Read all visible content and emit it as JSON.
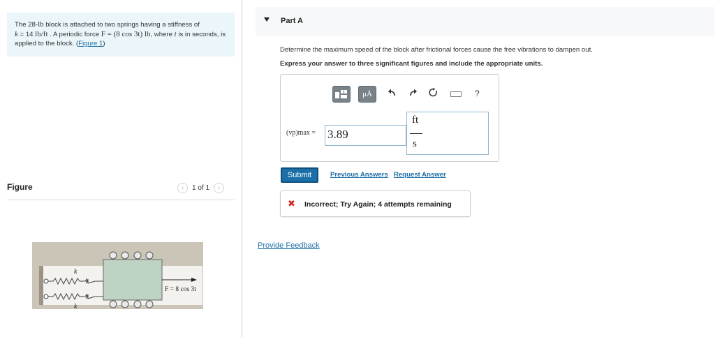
{
  "problem": {
    "text_1": "The 28-",
    "math_lb": "lb",
    "text_2": " block is attached to two springs having a stiffness of",
    "math_k": "k",
    "text_3": " = 14 ",
    "math_unit": "lb/ft",
    "text_4": " . A periodic force ",
    "math_force": "F = (8 cos 3t) lb",
    "text_5": ", where ",
    "math_t": "t",
    "text_6": " is in seconds, is applied to the block. (",
    "figure_link": "Figure 1",
    "text_7": ")"
  },
  "figure_panel": {
    "title": "Figure",
    "pager": "1 of 1",
    "prev_icon": "chevron-left-icon",
    "next_icon": "chevron-right-icon",
    "labels": {
      "k_top": "k",
      "k_bottom": "k",
      "force": "F = 8 cos 3t"
    },
    "colors": {
      "block": "#bfd3c4",
      "ground": "#c9c3b5",
      "wheel": "#e8e8e8"
    }
  },
  "part": {
    "title": "Part A",
    "question": "Determine the maximum speed of the block after frictional forces cause the free vibrations to dampen out.",
    "instruction": "Express your answer to three significant figures and include the appropriate units."
  },
  "toolbar": {
    "templates_icon": "templates-icon",
    "units_label": "μÅ",
    "undo_icon": "undo-icon",
    "redo_icon": "redo-icon",
    "reset_icon": "reset-icon",
    "keyboard_icon": "keyboard-icon",
    "help": "?"
  },
  "answer": {
    "variable": "(vp)max =",
    "value": "3.89",
    "unit_numerator": "ft",
    "unit_denominator": "s"
  },
  "actions": {
    "submit": "Submit",
    "previous_answers": "Previous Answers",
    "request_answer": "Request Answer"
  },
  "feedback": {
    "icon": "x-icon",
    "text": "Incorrect; Try Again; 4 attempts remaining",
    "color": "#d0261e"
  },
  "provide_feedback": "Provide Feedback",
  "colors": {
    "link": "#1a6ea8",
    "submit": "#1b6fa8",
    "problem_bg": "#eaf6fa"
  }
}
